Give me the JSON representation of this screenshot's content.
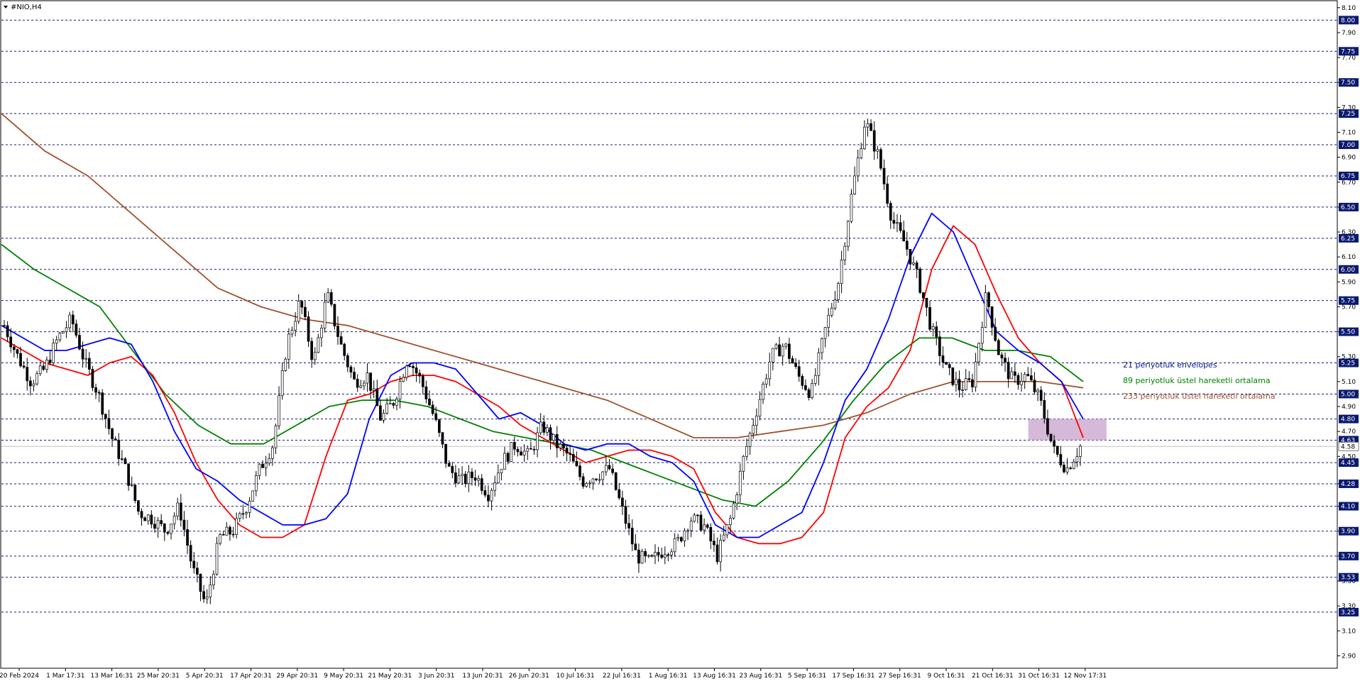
{
  "symbol_title": "#NIO,H4",
  "colors": {
    "background": "#ffffff",
    "candle": "#000000",
    "grid": "#1a1a6e",
    "tag_bg": "#0a1a6e",
    "price_line": "#c0c0c0",
    "envelope": "#0000ff",
    "ema_red": "#ff0000",
    "ema89": "#008000",
    "ema233": "#a0522d",
    "zone": "#c8a0cc"
  },
  "chart_data": {
    "type": "candlestick",
    "title": "#NIO,H4",
    "ylim": [
      2.8,
      8.15
    ],
    "x_ticks": [
      "20 Feb 2024",
      "1 Mar 17:31",
      "13 Mar 16:31",
      "25 Mar 20:31",
      "5 Apr 20:31",
      "17 Apr 20:31",
      "29 Apr 20:31",
      "9 May 20:31",
      "21 May 20:31",
      "3 Jun 20:31",
      "13 Jun 20:31",
      "26 Jun 20:31",
      "10 Jul 16:31",
      "22 Jul 16:31",
      "1 Aug 16:31",
      "13 Aug 16:31",
      "23 Aug 16:31",
      "5 Sep 16:31",
      "17 Sep 16:31",
      "27 Sep 16:31",
      "9 Oct 16:31",
      "21 Oct 16:31",
      "31 Oct 16:31",
      "12 Nov 17:31"
    ],
    "y_ticks": [
      "8.10",
      "7.90",
      "7.70",
      "7.50",
      "7.30",
      "7.10",
      "6.90",
      "6.70",
      "6.50",
      "6.30",
      "6.10",
      "5.90",
      "5.70",
      "5.50",
      "5.30",
      "5.10",
      "4.90",
      "4.70",
      "4.50",
      "4.28",
      "4.10",
      "3.90",
      "3.70",
      "3.50",
      "3.30",
      "3.10",
      "2.90"
    ],
    "level_lines": [
      "8.00",
      "7.75",
      "7.50",
      "7.25",
      "7.00",
      "6.75",
      "6.50",
      "6.25",
      "6.00",
      "5.75",
      "5.50",
      "5.25",
      "5.00",
      "4.80",
      "4.63",
      "4.45",
      "4.28",
      "4.10",
      "3.90",
      "3.70",
      "3.53",
      "3.25"
    ],
    "current_price": "4.58",
    "legend": [
      {
        "label": "21 periyotluk envelopes",
        "color": "#0a1a8c"
      },
      {
        "label": "89 periyotluk üstel hareketli ortalama",
        "color": "#008000"
      },
      {
        "label": "233 periyotluk üstel hareketli ortalama",
        "color": "#a0522d"
      }
    ],
    "zone": {
      "y_top": 4.8,
      "y_bottom": 4.63,
      "x_start": "31 Oct 16:31",
      "x_end": "12 Nov 17:31"
    },
    "series": [
      {
        "name": "Close (sampled)",
        "values": [
          5.55,
          5.3,
          5.1,
          5.2,
          5.45,
          5.6,
          5.25,
          5.0,
          4.65,
          4.4,
          4.05,
          4.0,
          3.9,
          4.1,
          3.6,
          3.3,
          3.85,
          3.9,
          4.1,
          4.4,
          4.6,
          5.4,
          5.75,
          5.25,
          5.8,
          5.4,
          5.1,
          5.15,
          4.8,
          4.95,
          5.3,
          5.1,
          4.8,
          4.4,
          4.3,
          4.35,
          4.2,
          4.45,
          4.6,
          4.5,
          4.75,
          4.6,
          4.5,
          4.3,
          4.35,
          4.4,
          4.05,
          3.7,
          3.65,
          3.75,
          3.8,
          4.0,
          3.95,
          3.7,
          4.0,
          4.5,
          4.9,
          5.3,
          5.4,
          5.15,
          5.0,
          5.5,
          5.9,
          6.6,
          7.2,
          6.9,
          6.4,
          6.2,
          5.9,
          5.5,
          5.2,
          5.05,
          5.1,
          5.8,
          5.3,
          5.1,
          5.15,
          4.95,
          4.55,
          4.4,
          4.58
        ]
      },
      {
        "name": "21 periyotluk envelopes",
        "values": [
          5.55,
          5.45,
          5.35,
          5.35,
          5.4,
          5.45,
          5.4,
          5.1,
          4.7,
          4.4,
          4.3,
          4.15,
          4.05,
          3.95,
          3.95,
          4.0,
          4.2,
          4.8,
          5.15,
          5.25,
          5.25,
          5.2,
          5.0,
          4.8,
          4.85,
          4.75,
          4.6,
          4.55,
          4.6,
          4.6,
          4.5,
          4.45,
          4.3,
          3.95,
          3.85,
          3.85,
          3.95,
          4.05,
          4.45,
          4.95,
          5.2,
          5.6,
          6.1,
          6.45,
          6.3,
          5.9,
          5.5,
          5.35,
          5.25,
          5.1,
          4.8
        ]
      },
      {
        "name": "EMA red",
        "values": [
          5.45,
          5.35,
          5.25,
          5.2,
          5.15,
          5.25,
          5.3,
          5.15,
          4.85,
          4.45,
          4.15,
          3.95,
          3.85,
          3.85,
          3.95,
          4.5,
          4.95,
          5.0,
          5.1,
          5.15,
          5.15,
          5.1,
          5.0,
          4.9,
          4.75,
          4.65,
          4.55,
          4.45,
          4.5,
          4.55,
          4.55,
          4.5,
          4.4,
          4.05,
          3.85,
          3.8,
          3.8,
          3.85,
          4.05,
          4.65,
          4.9,
          5.05,
          5.35,
          6.0,
          6.35,
          6.2,
          5.8,
          5.45,
          5.25,
          5.1,
          4.65
        ]
      },
      {
        "name": "89 periyotluk üstel hareketli ortalama",
        "values": [
          6.2,
          6.0,
          5.85,
          5.7,
          5.35,
          5.0,
          4.75,
          4.6,
          4.6,
          4.75,
          4.9,
          4.95,
          4.95,
          4.9,
          4.8,
          4.7,
          4.65,
          4.6,
          4.55,
          4.45,
          4.35,
          4.25,
          4.15,
          4.1,
          4.3,
          4.6,
          4.95,
          5.25,
          5.45,
          5.45,
          5.35,
          5.35,
          5.3,
          5.1
        ]
      },
      {
        "name": "233 periyotluk üstel hareketli ortalama",
        "values": [
          7.25,
          6.95,
          6.75,
          6.45,
          6.15,
          5.85,
          5.7,
          5.6,
          5.55,
          5.45,
          5.35,
          5.25,
          5.15,
          5.05,
          4.95,
          4.8,
          4.65,
          4.65,
          4.7,
          4.75,
          4.85,
          5.0,
          5.1,
          5.1,
          5.1,
          5.05
        ]
      }
    ]
  }
}
